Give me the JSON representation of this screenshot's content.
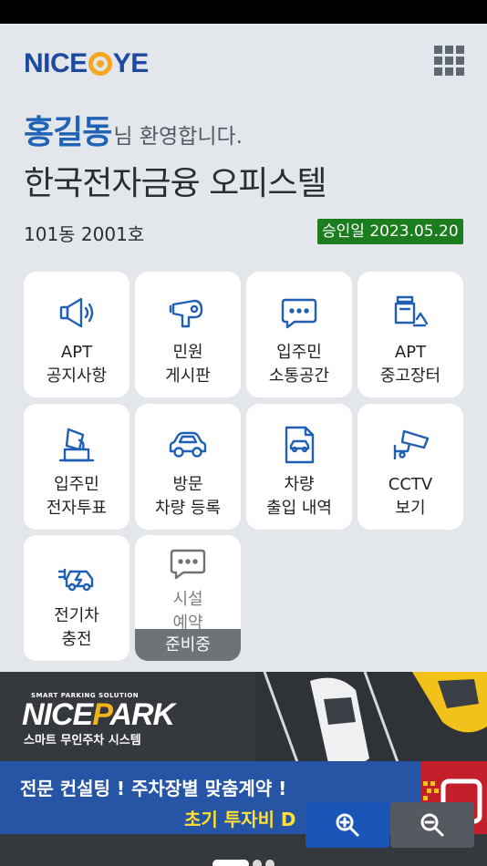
{
  "header": {
    "logo_left": "NICE",
    "logo_right": "YE",
    "menu_icon": "grid-menu-icon"
  },
  "welcome": {
    "name": "홍길동",
    "greeting": "님 환영합니다.",
    "complex_name": "한국전자금융 오피스텔",
    "unit": "101동 2001호",
    "approval": "승인일 2023.05.20"
  },
  "menu": {
    "items": [
      {
        "line1": "APT",
        "line2": "공지사항",
        "icon": "megaphone-icon"
      },
      {
        "line1": "민원",
        "line2": "게시판",
        "icon": "hair-dryer-icon"
      },
      {
        "line1": "입주민",
        "line2": "소통공간",
        "icon": "chat-bubble-icon"
      },
      {
        "line1": "APT",
        "line2": "중고장터",
        "icon": "recycle-bag-icon"
      },
      {
        "line1": "입주민",
        "line2": "전자투표",
        "icon": "ballot-box-icon"
      },
      {
        "line1": "방문",
        "line2": "차량 등록",
        "icon": "car-icon"
      },
      {
        "line1": "차량",
        "line2": "출입 내역",
        "icon": "car-document-icon"
      },
      {
        "line1": "CCTV",
        "line2": "보기",
        "icon": "cctv-camera-icon"
      },
      {
        "line1": "전기차",
        "line2": "충전",
        "icon": "ev-charging-icon"
      },
      {
        "line1": "시설",
        "line2": "예약",
        "icon": "chat-bubble-icon",
        "status": "준비중"
      }
    ]
  },
  "banner": {
    "tagline": "SMART PARKING SOLUTION",
    "brand_a": "NICE",
    "brand_p": "P",
    "brand_b": "ARK",
    "subtitle": "스마트 무인주차 시스템",
    "promo_line1": "전문 컨설팅 !  주차장별 맞춤계약 !",
    "promo_line2": "초기 투자비 D",
    "zoom_in_icon": "zoom-in-icon",
    "zoom_out_icon": "zoom-out-icon"
  },
  "colors": {
    "accent_blue": "#1f63b6",
    "approval_green": "#1b7d1e",
    "icon_blue": "#1f5fb4"
  }
}
